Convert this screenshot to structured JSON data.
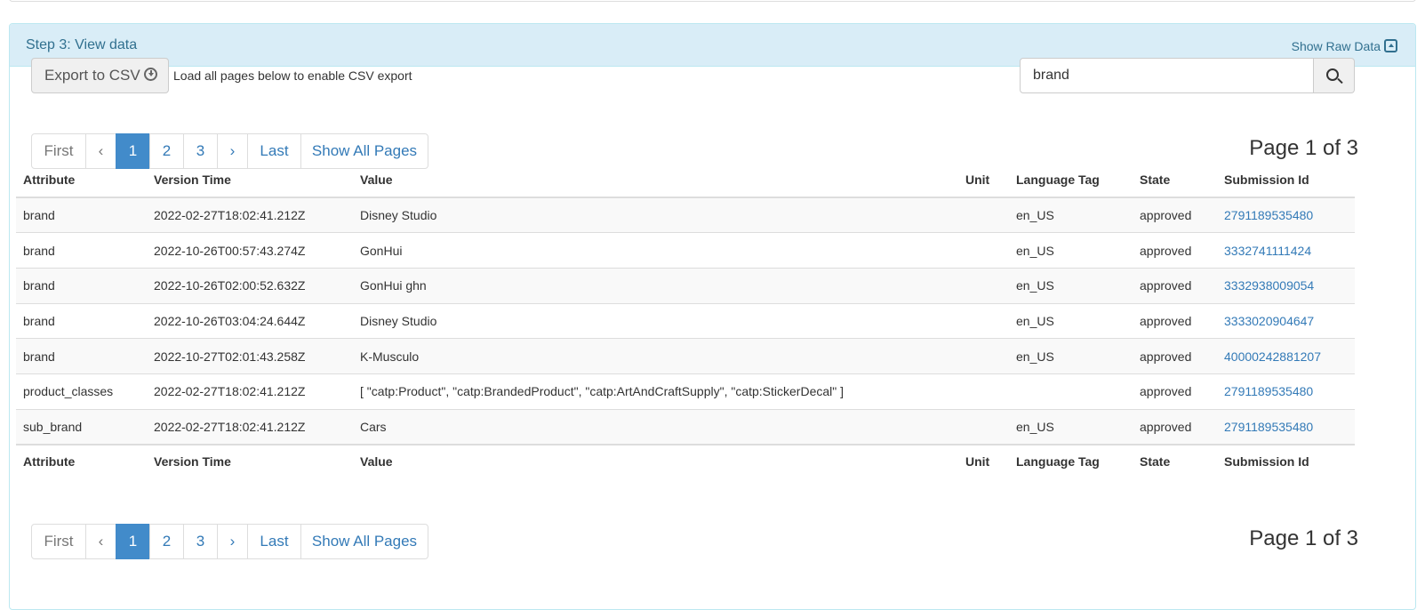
{
  "panel": {
    "title": "Step 3: View data",
    "raw_data_label": "Show Raw Data",
    "accent_color": "#31708f"
  },
  "toolbar": {
    "export_label": "Export to CSV",
    "export_note": "Load all pages below to enable CSV export",
    "search_value": "brand"
  },
  "pagination": {
    "items": [
      "First",
      "‹",
      "1",
      "2",
      "3",
      "›",
      "Last",
      "Show All Pages"
    ],
    "active": "1",
    "page_info": "Page 1 of 3"
  },
  "table": {
    "columns": [
      "Attribute",
      "Version Time",
      "Value",
      "Unit",
      "Language Tag",
      "State",
      "Submission Id"
    ],
    "rows": [
      {
        "attribute": "brand",
        "version_time": "2022-02-27T18:02:41.212Z",
        "value": "Disney Studio",
        "unit": "",
        "language_tag": "en_US",
        "state": "approved",
        "submission_id": "2791189535480"
      },
      {
        "attribute": "brand",
        "version_time": "2022-10-26T00:57:43.274Z",
        "value": "GonHui",
        "unit": "",
        "language_tag": "en_US",
        "state": "approved",
        "submission_id": "3332741111424"
      },
      {
        "attribute": "brand",
        "version_time": "2022-10-26T02:00:52.632Z",
        "value": "GonHui ghn",
        "unit": "",
        "language_tag": "en_US",
        "state": "approved",
        "submission_id": "3332938009054"
      },
      {
        "attribute": "brand",
        "version_time": "2022-10-26T03:04:24.644Z",
        "value": "Disney Studio",
        "unit": "",
        "language_tag": "en_US",
        "state": "approved",
        "submission_id": "3333020904647"
      },
      {
        "attribute": "brand",
        "version_time": "2022-10-27T02:01:43.258Z",
        "value": "K-Musculo",
        "unit": "",
        "language_tag": "en_US",
        "state": "approved",
        "submission_id": "40000242881207"
      },
      {
        "attribute": "product_classes",
        "version_time": "2022-02-27T18:02:41.212Z",
        "value": "[ \"catp:Product\", \"catp:BrandedProduct\", \"catp:ArtAndCraftSupply\", \"catp:StickerDecal\" ]",
        "unit": "",
        "language_tag": "",
        "state": "approved",
        "submission_id": "2791189535480"
      },
      {
        "attribute": "sub_brand",
        "version_time": "2022-02-27T18:02:41.212Z",
        "value": "Cars",
        "unit": "",
        "language_tag": "en_US",
        "state": "approved",
        "submission_id": "2791189535480"
      }
    ]
  }
}
